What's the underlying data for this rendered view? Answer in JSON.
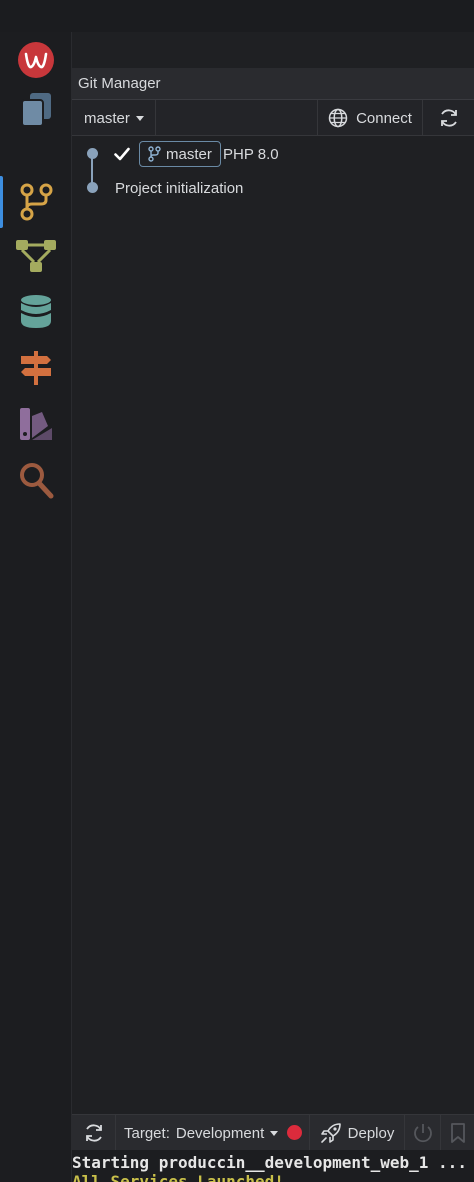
{
  "panel": {
    "title": "Git Manager",
    "branch_select": "master",
    "connect_label": "Connect"
  },
  "commits": [
    {
      "checked": true,
      "branch_tag": "master",
      "label": "PHP 8.0"
    },
    {
      "checked": false,
      "message": "Project initialization"
    }
  ],
  "statusbar": {
    "target_prefix": "Target:",
    "target_value": "Development",
    "deploy_label": "Deploy",
    "status_color": "#dc2b3c"
  },
  "terminal": {
    "line1": "Starting produccin__development_web_1 ...",
    "line2": "All Services Launched!"
  },
  "activity_bar": {
    "items": [
      "logo-icon",
      "files-icon",
      "git-branch-icon",
      "workflow-icon",
      "database-icon",
      "signpost-icon",
      "palette-icon",
      "search-icon"
    ],
    "active": "git-branch-icon"
  },
  "colors": {
    "accent": "#3d8ee0",
    "graph": "#8aa2bb",
    "logo": "#c8373b"
  }
}
